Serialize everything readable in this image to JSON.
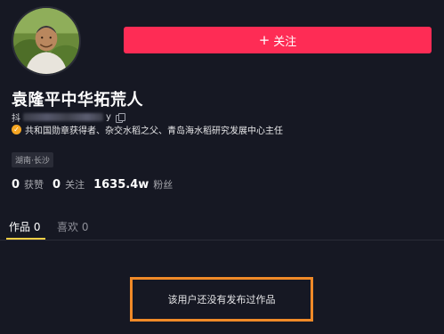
{
  "profile": {
    "name": "袁隆平中华拓荒人",
    "douyin_id_prefix": "抖",
    "douyin_id_suffix": "y",
    "verification": "共和国勋章获得者、杂交水稻之父、青岛海水稻研究发展中心主任",
    "location": "湖南·长沙"
  },
  "follow_button": {
    "icon": "+",
    "label": "关注"
  },
  "stats": {
    "likes_count": "0",
    "likes_label": "获赞",
    "following_count": "0",
    "following_label": "关注",
    "followers_count": "1635.4w",
    "followers_label": "粉丝"
  },
  "tabs": [
    {
      "label": "作品 0",
      "active": true
    },
    {
      "label": "喜欢 0",
      "active": false
    }
  ],
  "empty_state": {
    "message": "该用户还没有发布过作品"
  },
  "colors": {
    "background": "#161823",
    "follow_button": "#fe2c55",
    "tab_underline": "#facf46",
    "highlight_box": "#f08a28",
    "verify_badge": "#f5a623"
  },
  "icons": {
    "copy": "copy-icon",
    "verified": "verified-badge-icon"
  }
}
